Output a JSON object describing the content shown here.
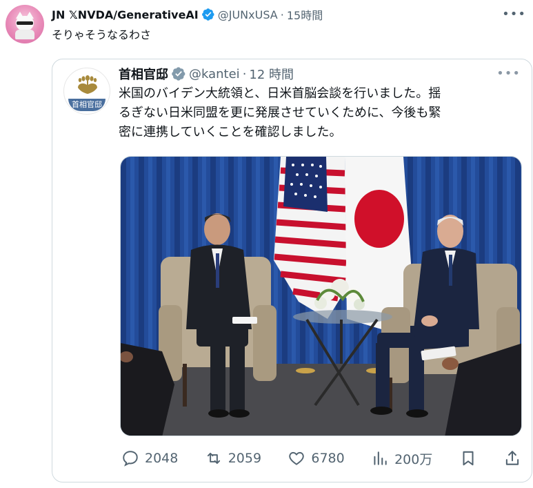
{
  "tweet": {
    "author_name": "JN 𝕏NVDA/GenerativeAI",
    "handle": "@JUNxUSA",
    "separator": "·",
    "time": "15時間",
    "text": "そりゃそうなるわさ",
    "avatar_icon": "cat-with-sunglasses-avatar"
  },
  "quote": {
    "author_name": "首相官邸",
    "handle": "@kantei",
    "separator": "·",
    "time": "12 時間",
    "avatar_band_text": "首相官邸",
    "text_lines": [
      "米国のバイデン大統領と、日米首脳会談を行いました。揺",
      "るぎない日米同盟を更に発展させていくために、今後も緊",
      "密に連携していくことを確認しました。"
    ]
  },
  "actions": {
    "replies": "2048",
    "retweets": "2059",
    "likes": "6780",
    "views": "200万"
  },
  "colors": {
    "text": "#0f1419",
    "secondary": "#536471",
    "verified": "#1d9bf0",
    "border": "#cfd9de"
  }
}
